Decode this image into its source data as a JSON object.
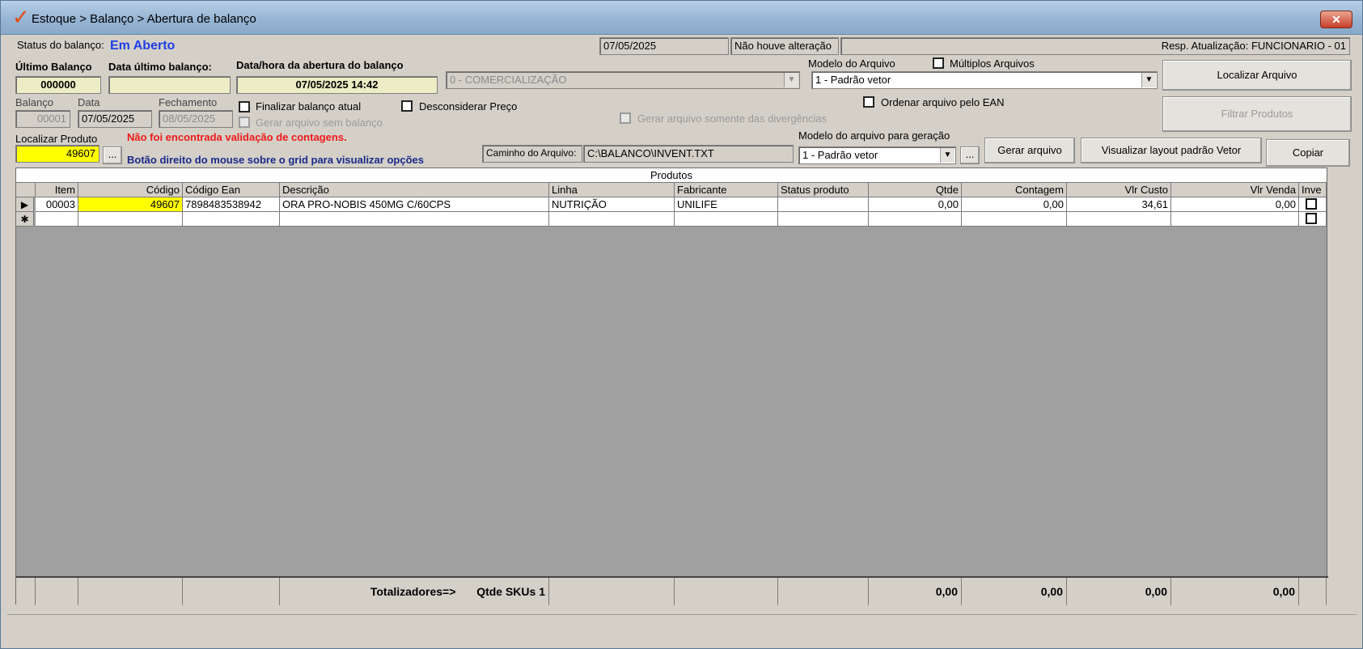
{
  "window": {
    "title": "Estoque > Balanço > Abertura de balanço",
    "close_label": "✕"
  },
  "status": {
    "label": "Status do balanço:",
    "value": "Em Aberto",
    "date": "07/05/2025",
    "change": "Não houve alteração",
    "resp": "Resp. Atualização: FUNCIONARIO - 01"
  },
  "last_balance": {
    "label": "Último Balanço",
    "value": "000000",
    "date_label": "Data último balanço:",
    "date_value": "",
    "open_label": "Data/hora da abertura do balanço",
    "open_value": "07/05/2025 14:42"
  },
  "comercializacao": "0 - COMERCIALIZAÇÃO",
  "file_model": {
    "label": "Modelo do Arquivo",
    "value": "1 - Padrão vetor",
    "multiple_label": "Múltiplos Arquivos"
  },
  "buttons": {
    "localizar_arquivo": "Localizar Arquivo",
    "filtrar_produtos": "Filtrar Produtos",
    "gerar_arquivo": "Gerar arquivo",
    "visualizar_layout": "Visualizar layout padrão Vetor",
    "copiar": "Copiar",
    "ellipsis": "...",
    "ellipsis2": "..."
  },
  "balance": {
    "balanco_label": "Balanço",
    "balanco_value": "00001",
    "data_label": "Data",
    "data_value": "07/05/2025",
    "fechamento_label": "Fechamento",
    "fechamento_value": "08/05/2025"
  },
  "checks": {
    "finalizar": "Finalizar balanço atual",
    "sem_balanco": "Gerar arquivo sem balanço",
    "desconsiderar": "Desconsiderar Preço",
    "divergencias": "Gerar arquivo somente das divergências",
    "ordenar_ean": "Ordenar arquivo pelo EAN"
  },
  "product_search": {
    "label": "Localizar Produto",
    "value": "49607",
    "warning": "Não foi encontrada validação de contagens.",
    "hint": "Botão direito do mouse sobre o grid para visualizar opções"
  },
  "path": {
    "label": "Caminho do Arquivo:",
    "value": "C:\\BALANCO\\INVENT.TXT"
  },
  "generation_model": {
    "label": "Modelo do arquivo para geração",
    "value": "1 - Padrão vetor"
  },
  "grid": {
    "caption": "Produtos",
    "columns": [
      "Item",
      "Código",
      "Código Ean",
      "Descrição",
      "Linha",
      "Fabricante",
      "Status produto",
      "Qtde",
      "Contagem",
      "Vlr Custo",
      "Vlr Venda",
      "Inve"
    ],
    "rows": [
      {
        "item": "00003",
        "codigo": "49607",
        "ean": "7898483538942",
        "descricao": "ORA PRO-NOBIS 450MG C/60CPS",
        "linha": "NUTRIÇÃO",
        "fabricante": "UNILIFE",
        "status": "",
        "qtde": "0,00",
        "contagem": "0,00",
        "custo": "34,61",
        "venda": "0,00"
      }
    ],
    "new_row_marker": "✱",
    "current_row_marker": "▶",
    "footer": {
      "totalizadores": "Totalizadores=>",
      "skus": "Qtde SKUs 1",
      "qtde": "0,00",
      "contagem": "0,00",
      "custo": "0,00",
      "venda": "0,00"
    }
  }
}
